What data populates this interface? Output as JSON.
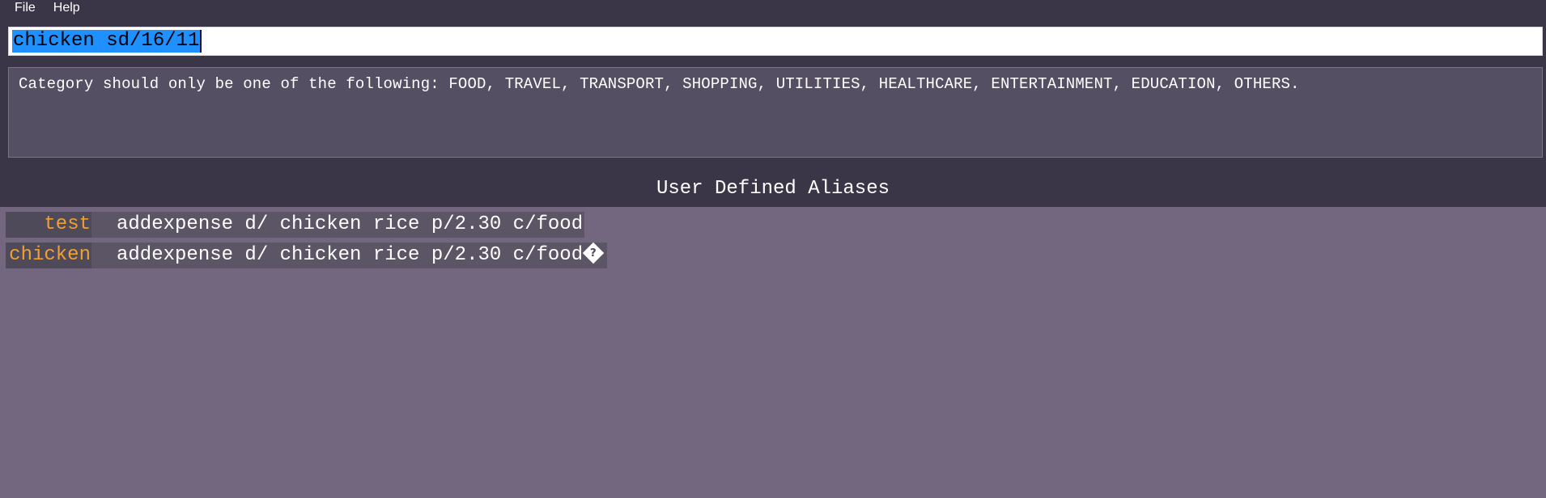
{
  "menu": {
    "file_label": "File",
    "help_label": "Help"
  },
  "command_box": {
    "value": "chicken sd/16/11"
  },
  "result_display": {
    "message": "Category should only be one of the following: FOOD, TRAVEL, TRANSPORT, SHOPPING, UTILITIES, HEALTHCARE, ENTERTAINMENT, EDUCATION, OTHERS."
  },
  "aliases": {
    "title": "User Defined Aliases",
    "items": [
      {
        "name": "test",
        "command": "addexpense d/ chicken rice p/2.30 c/food"
      },
      {
        "name": "chicken",
        "command": "addexpense d/ chicken rice p/2.30 c/food",
        "trailing_glyph": "?"
      }
    ]
  },
  "colors": {
    "background": "#3b3647",
    "result_box": "#554f63",
    "alias_panel": "#73667f",
    "alias_name_text": "#f0a030",
    "selection_highlight": "#1e90ff"
  }
}
